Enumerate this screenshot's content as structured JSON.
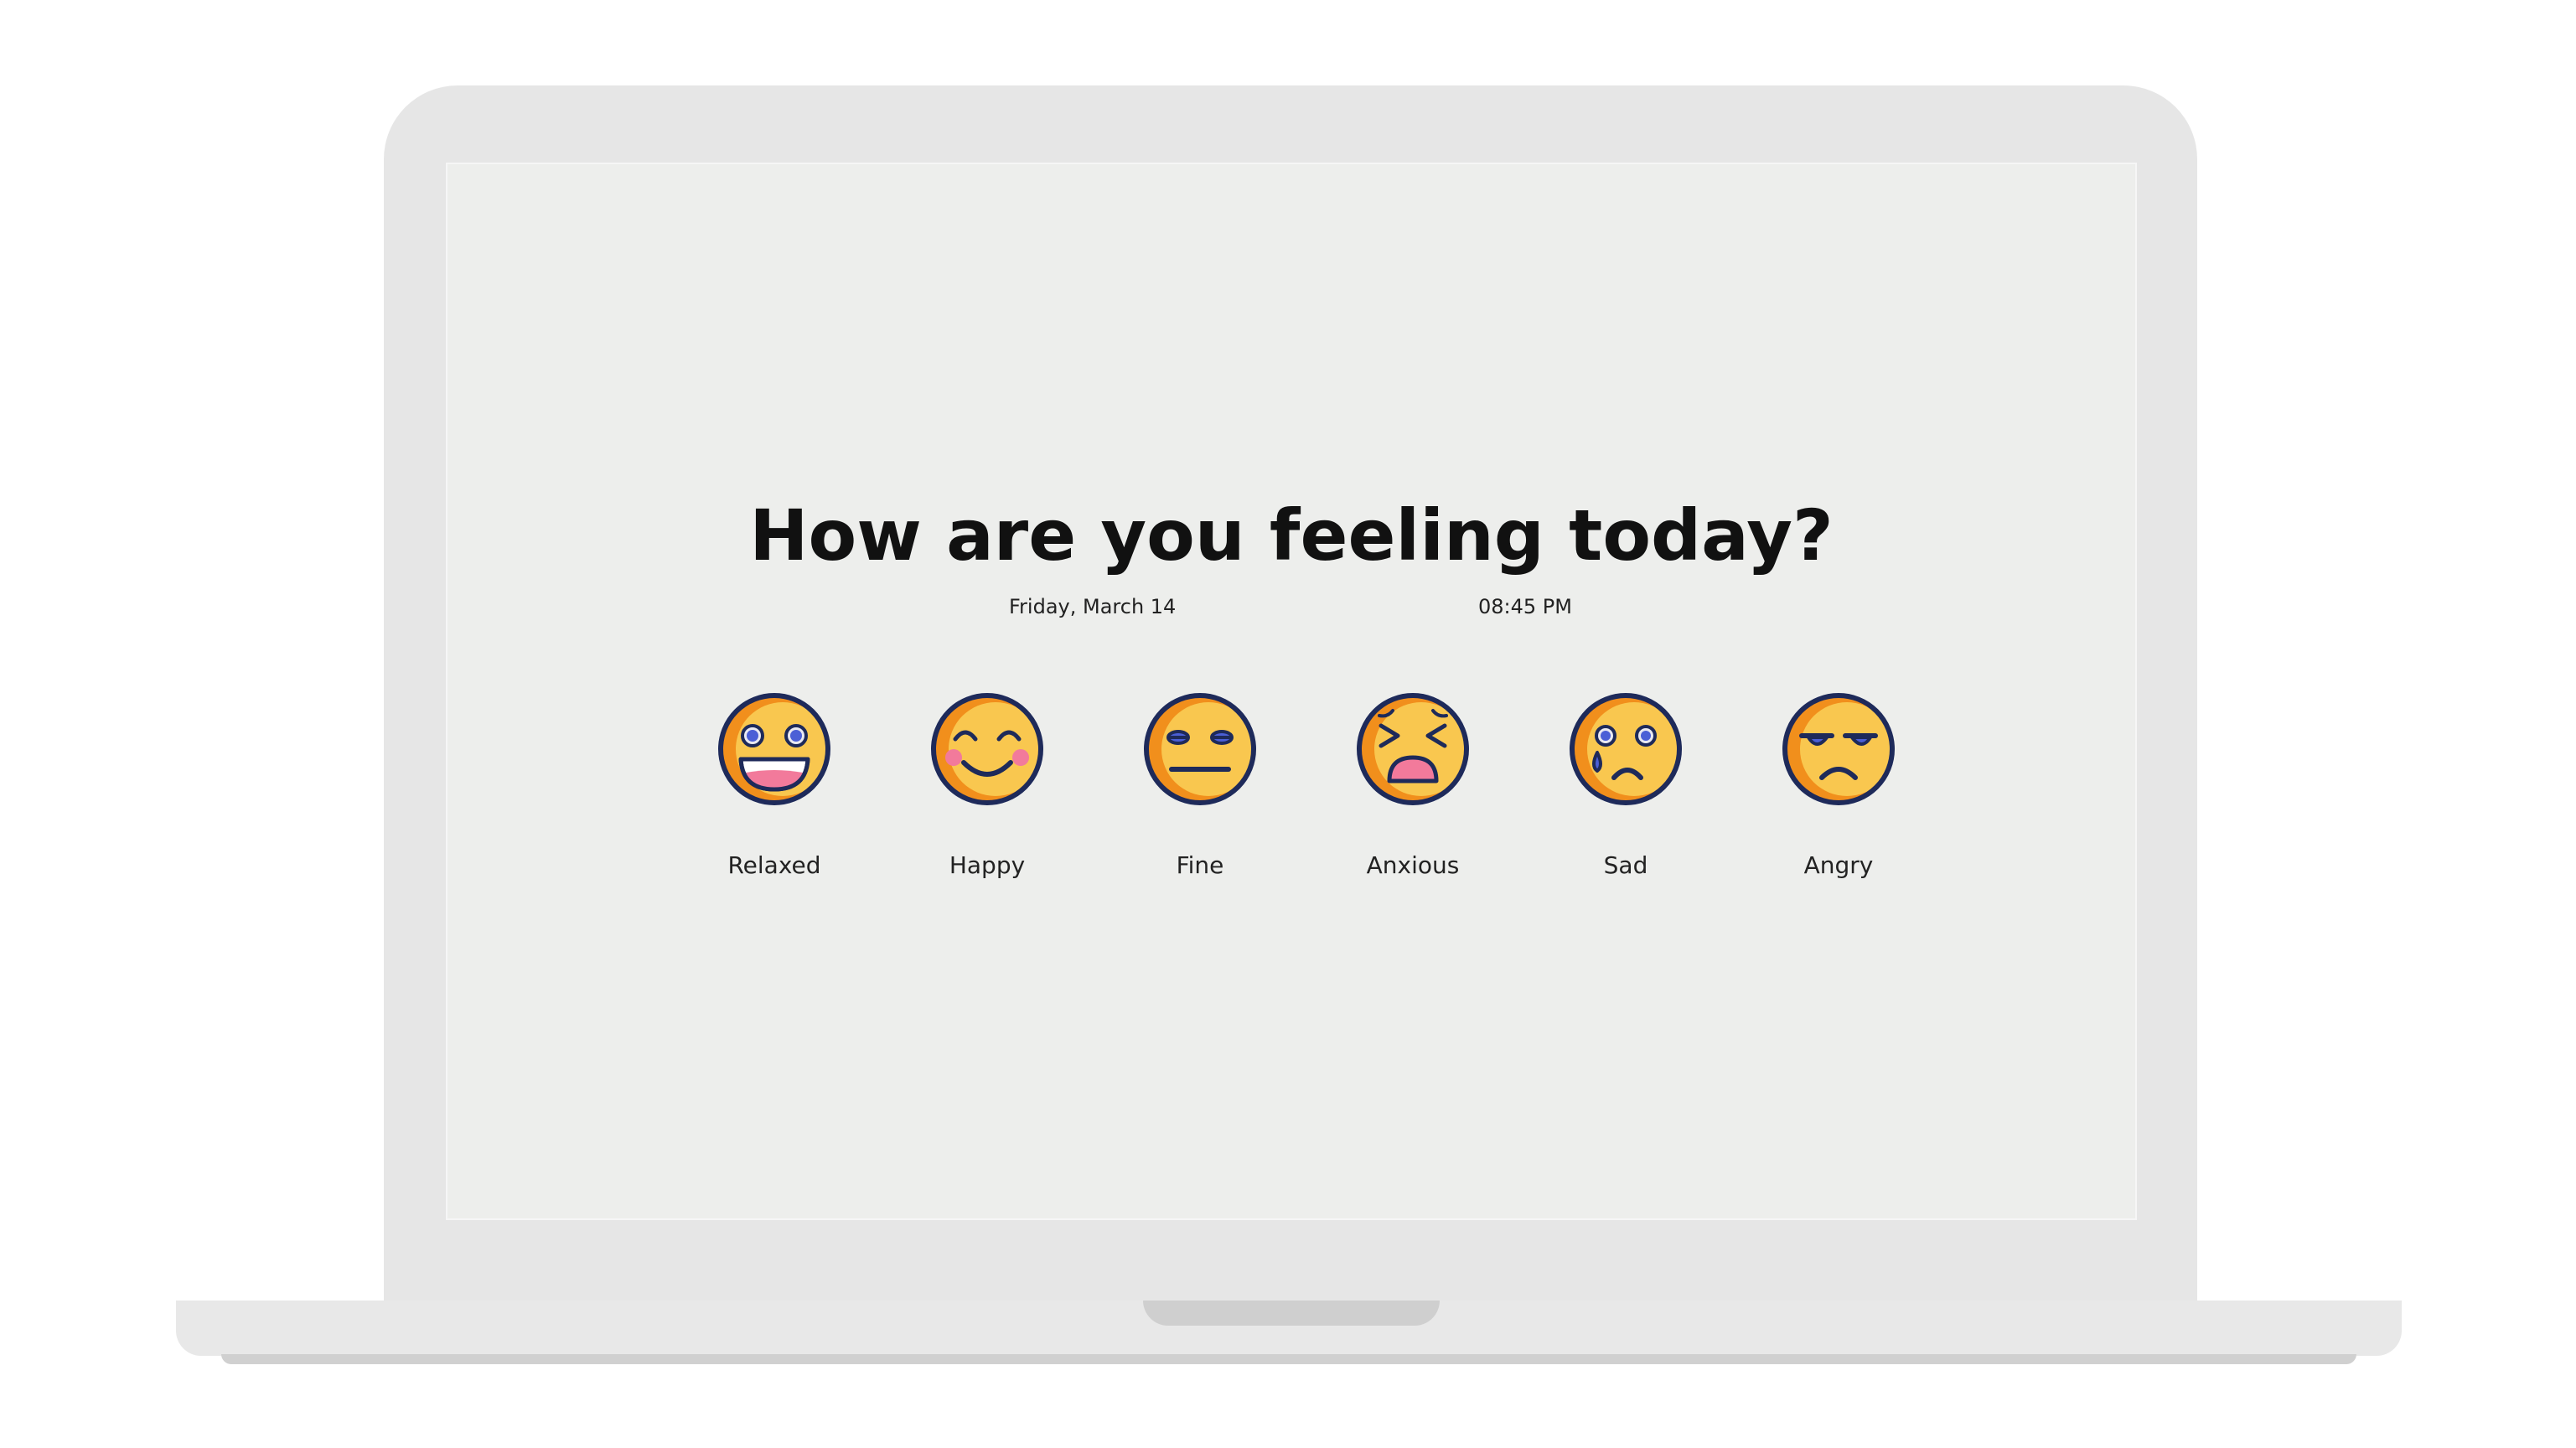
{
  "screen": {
    "title": "How are you feeling today?",
    "date": "Friday, March 14",
    "time": "08:45 PM"
  },
  "moods": [
    {
      "label": "Relaxed",
      "icon": "grinning-face-icon"
    },
    {
      "label": "Happy",
      "icon": "smiling-face-blush-icon"
    },
    {
      "label": "Fine",
      "icon": "neutral-face-icon"
    },
    {
      "label": "Anxious",
      "icon": "tired-face-icon"
    },
    {
      "label": "Sad",
      "icon": "crying-face-icon"
    },
    {
      "label": "Angry",
      "icon": "angry-face-icon"
    }
  ],
  "colors": {
    "face_fill": "#f9c74f",
    "face_shade": "#f18f1c",
    "outline": "#1e2a5a",
    "iris": "#4b5fd6",
    "mouth_pink": "#f27a9b",
    "screen_bg": "#edeeec",
    "laptop_body": "#e6e6e6"
  }
}
